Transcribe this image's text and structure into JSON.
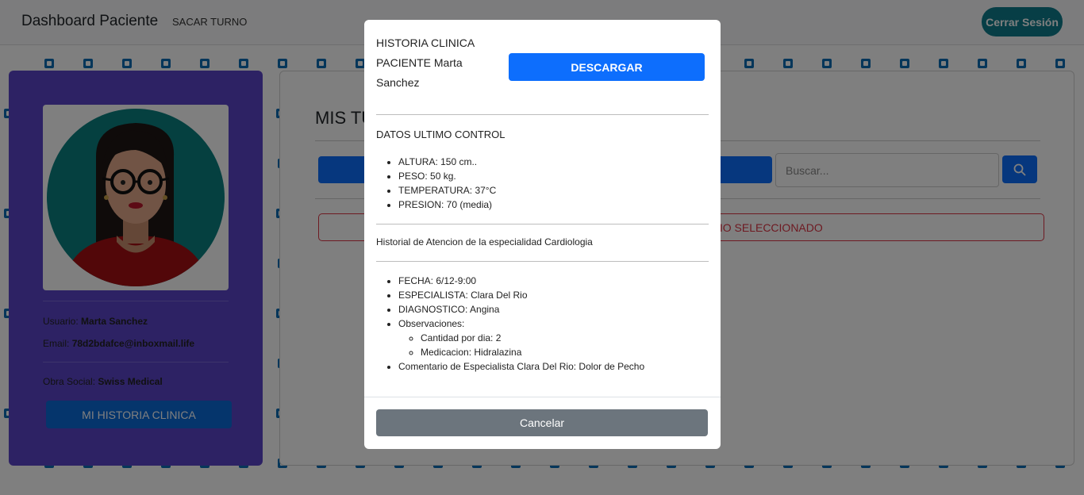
{
  "navbar": {
    "brand": "Dashboard Paciente",
    "nav_link": "SACAR TURNO",
    "logout_label": "Cerrar Sesión",
    "logout_color": "#0f7c8c"
  },
  "profile": {
    "usuario_label": "Usuario:",
    "usuario_value": "Marta Sanchez",
    "email_label": "Email:",
    "email_value": "78d2bdafce@inboxmail.life",
    "obra_label": "Obra Social:",
    "obra_value": "Swiss Medical",
    "hc_button": "MI HISTORIA CLINICA",
    "card_color": "#5a44c9"
  },
  "main": {
    "title": "MIS TURNOS",
    "search_placeholder": "Buscar...",
    "alert_text": "NO HAY TURNOS CON EL CRITERIO SELECCIONADO"
  },
  "modal": {
    "title_line1": "HISTORIA CLINICA",
    "title_line2": "PACIENTE Marta Sanchez",
    "download_label": "DESCARGAR",
    "control_heading": "DATOS ULTIMO CONTROL",
    "control_items": [
      "ALTURA: 150 cm..",
      "PESO: 50 kg.",
      "TEMPERATURA: 37°C",
      "PRESION: 70 (media)"
    ],
    "history_heading": "Historial de Atencion de la especialidad Cardiologia",
    "history_items": {
      "fecha": "FECHA: 6/12-9:00",
      "especialista": "ESPECIALISTA: Clara Del Rio",
      "diagnostico": "DIAGNOSTICO: Angina",
      "observaciones": "Observaciones:",
      "obs_sub": [
        "Cantidad por dia: 2",
        "Medicacion: Hidralazina"
      ],
      "comentario": "Comentario de Especialista Clara Del Rio: Dolor de Pecho"
    },
    "cancel_label": "Cancelar"
  }
}
